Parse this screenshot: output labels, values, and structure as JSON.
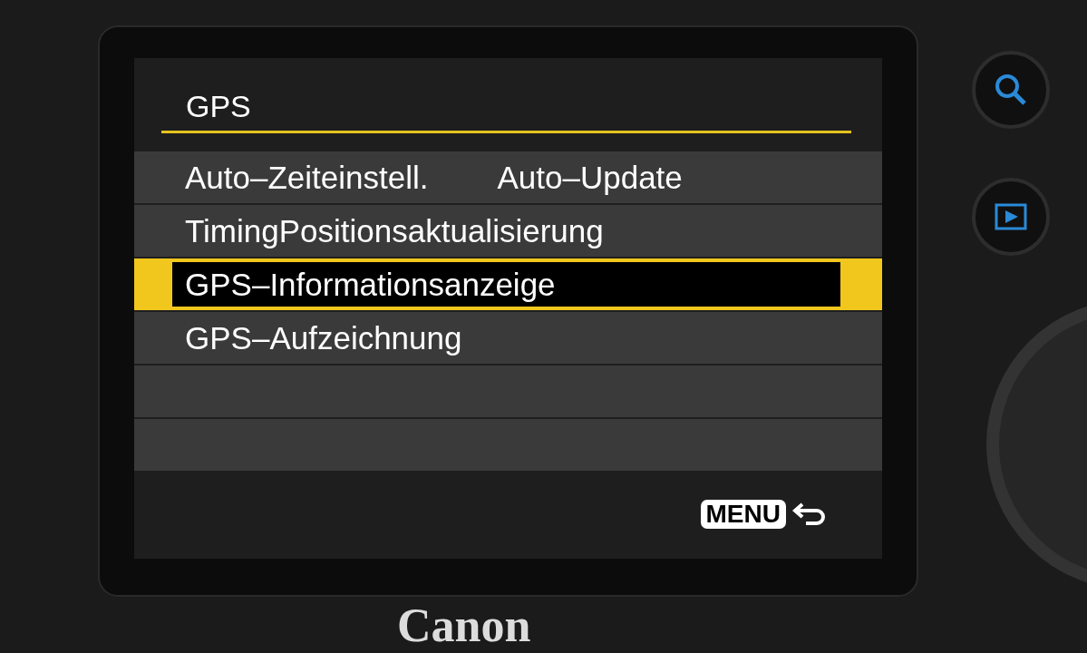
{
  "screen": {
    "title": "GPS",
    "items": [
      {
        "label": "Auto–Zeiteinstell.",
        "value": "Auto–Update",
        "selected": false
      },
      {
        "label": "TimingPositionsaktualisierung",
        "selected": false
      },
      {
        "label": "GPS–Informationsanzeige",
        "selected": true
      },
      {
        "label": "GPS–Aufzeichnung",
        "selected": false
      }
    ],
    "menu_key": "MENU"
  },
  "camera": {
    "brand": "Canon"
  }
}
